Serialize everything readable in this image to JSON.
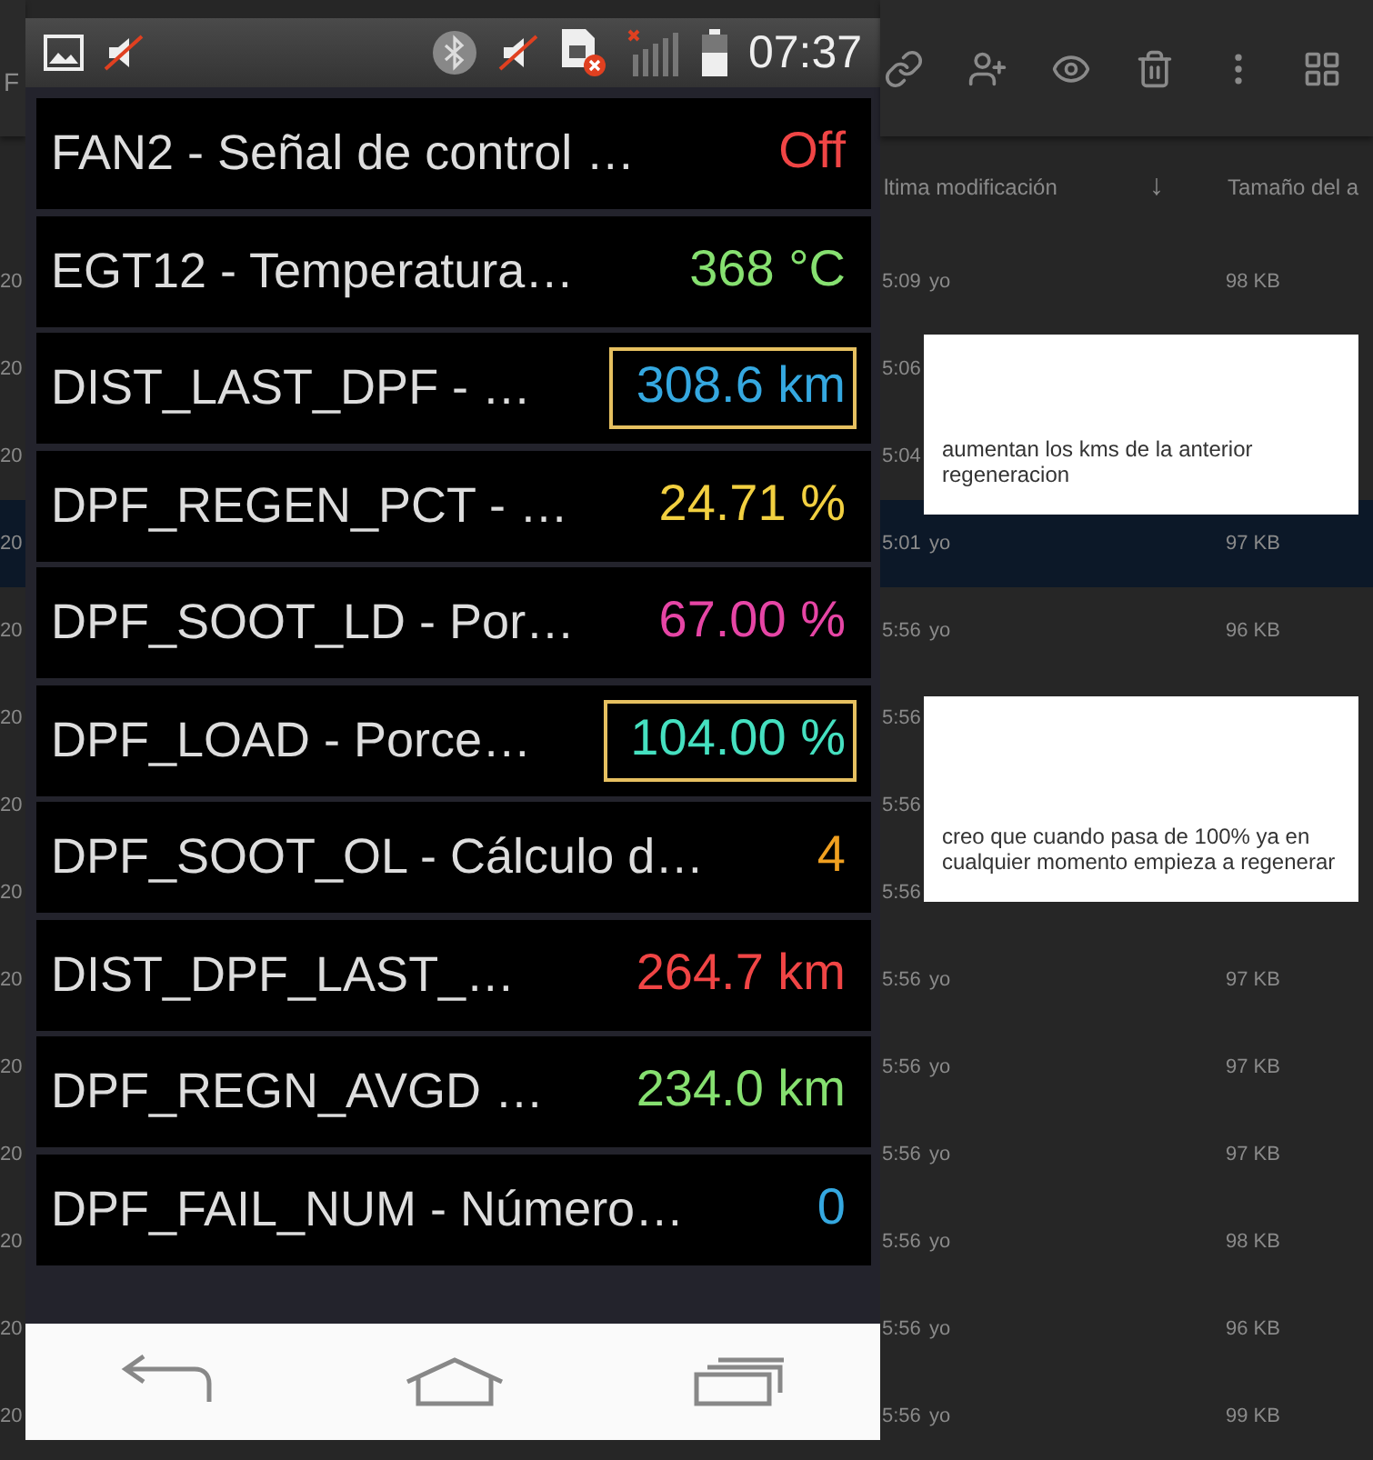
{
  "drive": {
    "toolbar": {
      "title": "F"
    },
    "columns": [
      {
        "label": "ltima modificación",
        "kind": "text"
      },
      {
        "label": "↓",
        "kind": "sort"
      },
      {
        "label": "Tamaño del a",
        "kind": "text"
      }
    ],
    "rows": [
      {
        "date": "20",
        "time": "5:09",
        "owner": "yo",
        "size": "98 KB",
        "selected": false
      },
      {
        "date": "20",
        "time": "5:06",
        "selected": false
      },
      {
        "date": "20",
        "time": "5:04",
        "selected": false
      },
      {
        "date": "20",
        "time": "5:01",
        "owner": "yo",
        "size": "97 KB",
        "selected": true
      },
      {
        "date": "20",
        "time": "5:56",
        "owner": "yo",
        "size": "96 KB",
        "selected": false
      },
      {
        "date": "20",
        "time": "5:56",
        "selected": false
      },
      {
        "date": "20",
        "time": "5:56",
        "selected": false
      },
      {
        "date": "20",
        "time": "5:56",
        "selected": false
      },
      {
        "date": "20",
        "time": "5:56",
        "owner": "yo",
        "size": "97 KB",
        "selected": false
      },
      {
        "date": "20",
        "time": "5:56",
        "owner": "yo",
        "size": "97 KB",
        "selected": false
      },
      {
        "date": "20",
        "time": "5:56",
        "owner": "yo",
        "size": "97 KB",
        "selected": false
      },
      {
        "date": "20",
        "time": "5:56",
        "owner": "yo",
        "size": "98 KB",
        "selected": false
      },
      {
        "date": "20",
        "time": "5:56",
        "owner": "yo",
        "size": "96 KB",
        "selected": false
      },
      {
        "date": "20",
        "time": "5:56",
        "owner": "yo",
        "size": "99 KB",
        "selected": false
      }
    ]
  },
  "phone": {
    "status_bar": {
      "time": "07:37"
    },
    "items": [
      {
        "name": "FAN2 - Señal de control …",
        "value": "Off",
        "color": "#f04545",
        "highlighted": false
      },
      {
        "name": "EGT12 - Temperatura…",
        "value": "368 °C",
        "color": "#86e070",
        "highlighted": false
      },
      {
        "name": "DIST_LAST_DPF - …",
        "value": "308.6 km",
        "color": "#35a8e0",
        "highlighted": true
      },
      {
        "name": "DPF_REGEN_PCT - …",
        "value": "24.71 %",
        "color": "#f2d040",
        "highlighted": false
      },
      {
        "name": "DPF_SOOT_LD - Por…",
        "value": "67.00 %",
        "color": "#e645a5",
        "highlighted": false
      },
      {
        "name": "DPF_LOAD - Porce…",
        "value": "104.00 %",
        "color": "#45e0c0",
        "highlighted": true
      },
      {
        "name": "DPF_SOOT_OL - Cálculo d…",
        "value": "4",
        "color": "#f0a020",
        "highlighted": false
      },
      {
        "name": "DIST_DPF_LAST_…",
        "value": "264.7 km",
        "color": "#f04545",
        "highlighted": false
      },
      {
        "name": "DPF_REGN_AVGD …",
        "value": "234.0 km",
        "color": "#86e070",
        "highlighted": false
      },
      {
        "name": "DPF_FAIL_NUM - Número…",
        "value": "0",
        "color": "#35a8e0",
        "highlighted": false
      }
    ]
  },
  "notes": [
    {
      "text": "aumentan los kms de la anterior regeneracion"
    },
    {
      "text": "creo que cuando pasa de 100% ya en cualquier momento empieza a regenerar"
    }
  ]
}
